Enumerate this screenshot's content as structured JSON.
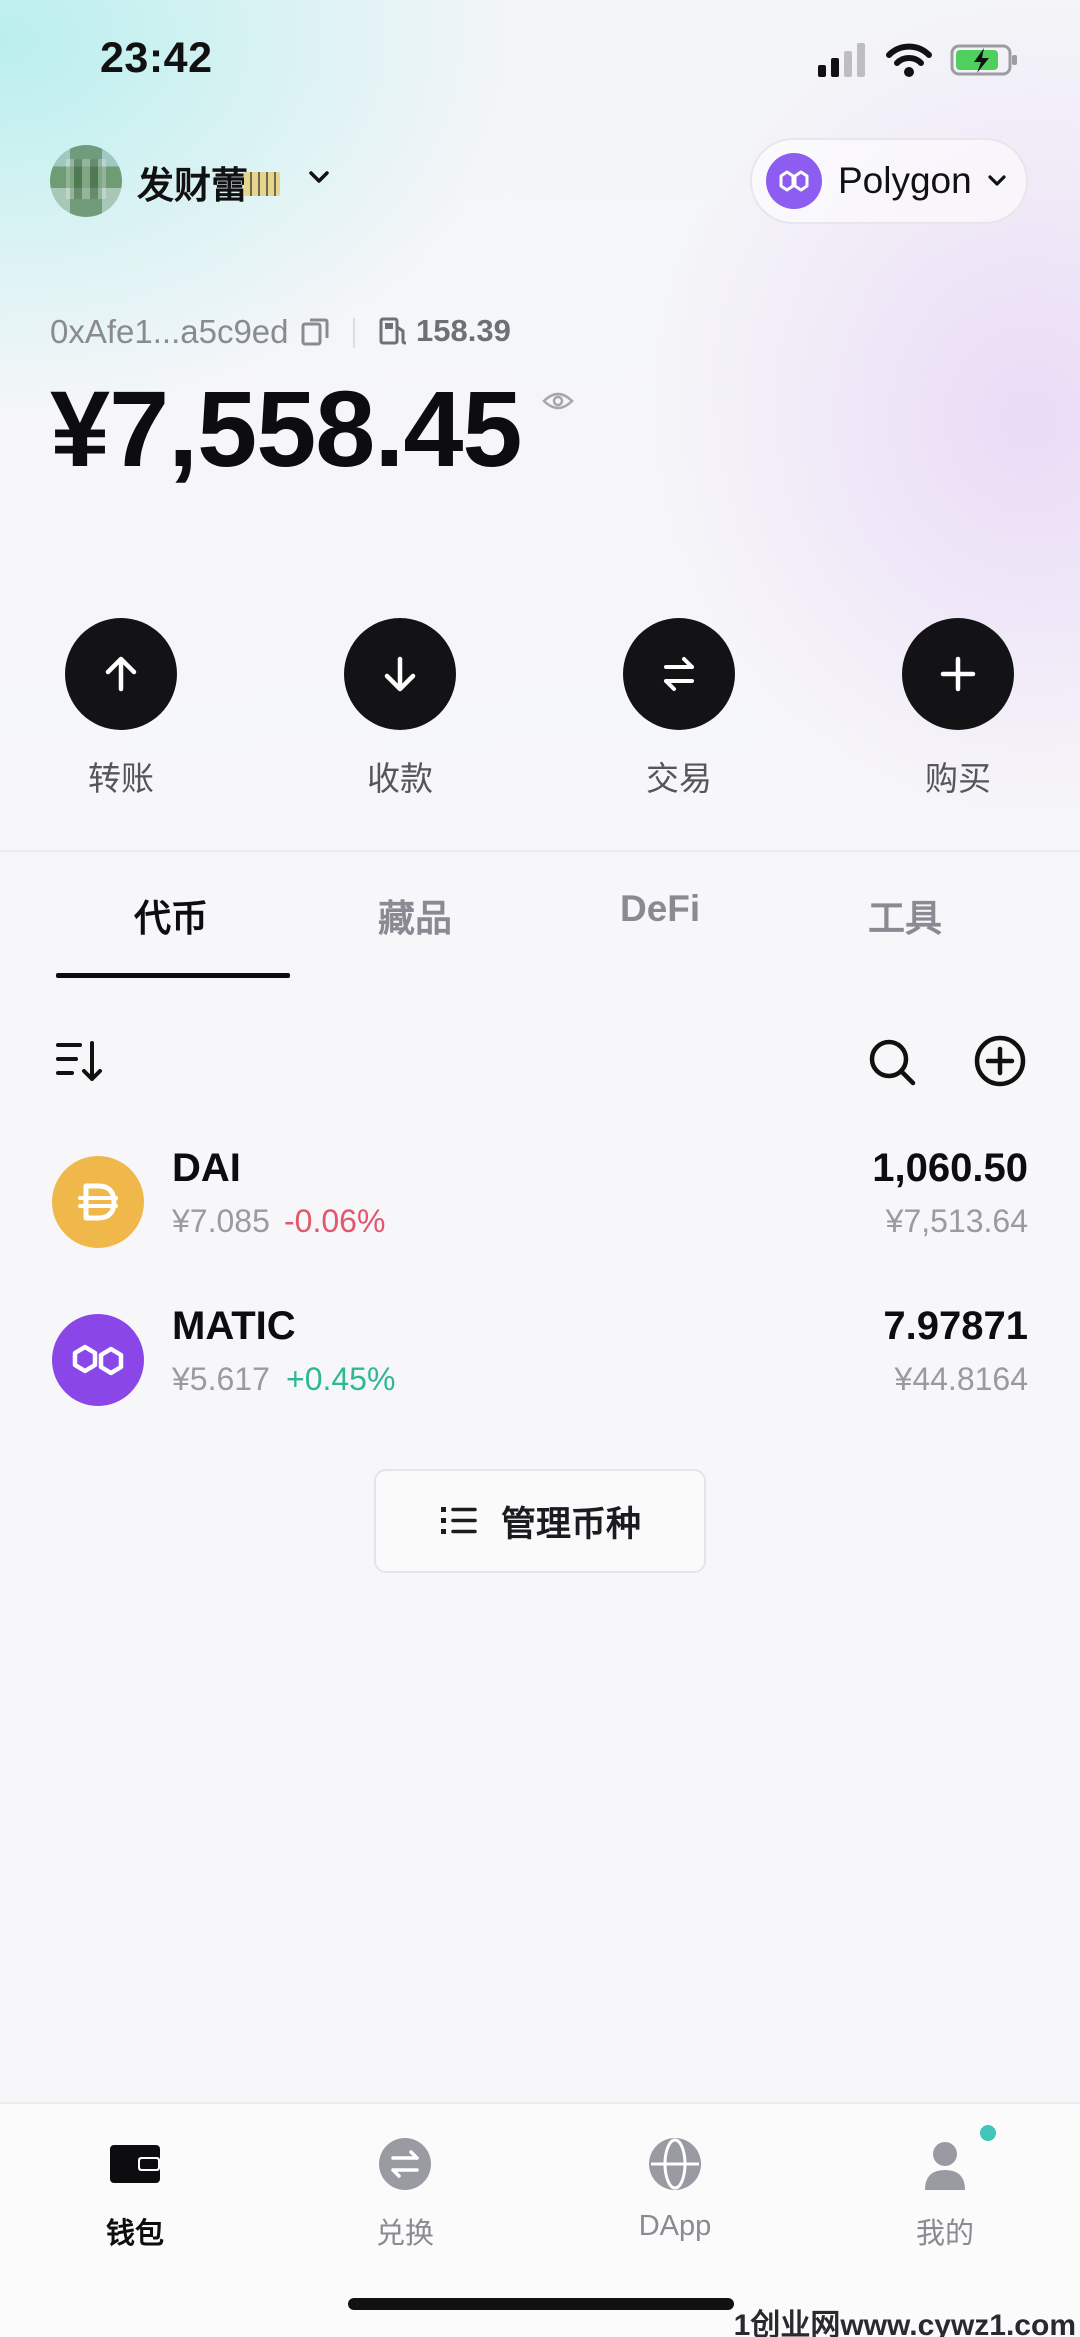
{
  "status_bar": {
    "time": "23:42"
  },
  "header": {
    "wallet_name": "发财蕾",
    "network": "Polygon"
  },
  "account": {
    "address": "0xAfe1...a5c9ed",
    "gas": "158.39",
    "balance": "¥7,558.45"
  },
  "actions": [
    {
      "label": "转账",
      "icon": "arrow-up-icon"
    },
    {
      "label": "收款",
      "icon": "arrow-down-icon"
    },
    {
      "label": "交易",
      "icon": "swap-icon"
    },
    {
      "label": "购买",
      "icon": "plus-icon"
    }
  ],
  "tabs": [
    {
      "label": "代币",
      "active": true
    },
    {
      "label": "藏品",
      "active": false
    },
    {
      "label": "DeFi",
      "active": false
    },
    {
      "label": "工具",
      "active": false
    }
  ],
  "tokens": [
    {
      "symbol": "DAI",
      "price": "¥7.085",
      "change": "-0.06%",
      "change_color": "#e2566e",
      "amount": "1,060.50",
      "fiat": "¥7,513.64",
      "logo_color": "#f0b84a"
    },
    {
      "symbol": "MATIC",
      "price": "¥5.617",
      "change": "+0.45%",
      "change_color": "#2eb896",
      "amount": "7.97871",
      "fiat": "¥44.8164",
      "logo_color": "#8a46e6"
    }
  ],
  "manage_button": {
    "label": "管理币种"
  },
  "bottom_nav": [
    {
      "label": "钱包",
      "icon": "wallet-icon",
      "active": true
    },
    {
      "label": "兑换",
      "icon": "exchange-icon",
      "active": false
    },
    {
      "label": "DApp",
      "icon": "globe-icon",
      "active": false
    },
    {
      "label": "我的",
      "icon": "profile-icon",
      "active": false
    }
  ],
  "watermark": "1创业网www.cywz1.com",
  "colors": {
    "accent": "#131316",
    "polygon": "#8d5cf0",
    "notification_dot": "#3fc6b8"
  }
}
